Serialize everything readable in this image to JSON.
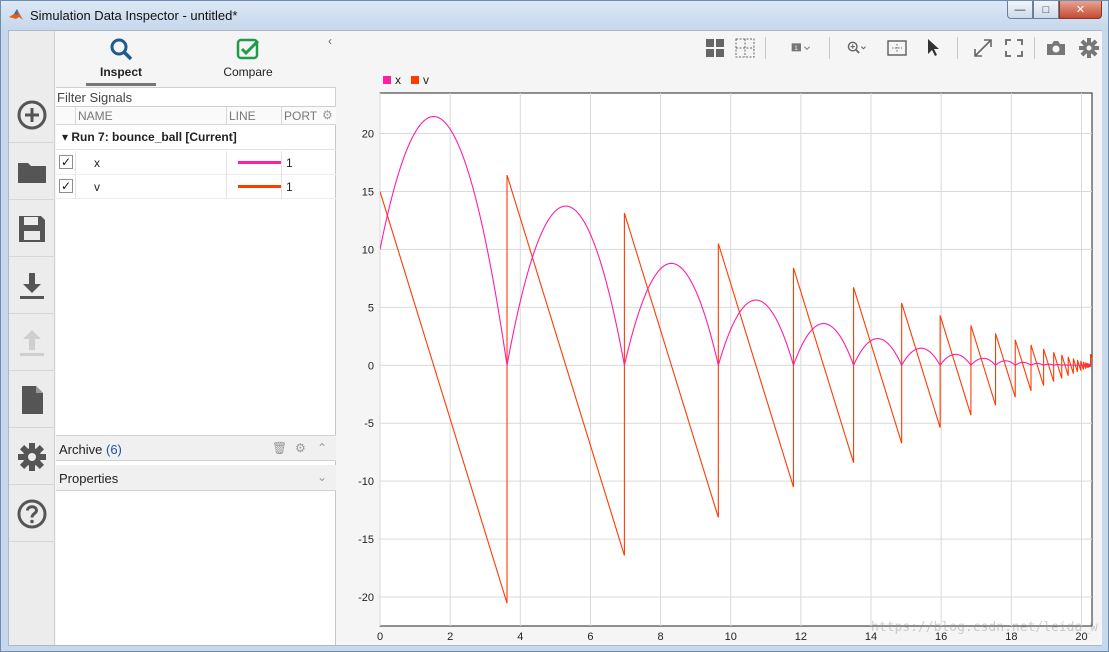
{
  "window": {
    "title": "Simulation Data Inspector - untitled*"
  },
  "tabs": [
    {
      "label": "Inspect",
      "active": true
    },
    {
      "label": "Compare",
      "active": false
    }
  ],
  "filter": {
    "placeholder": "Filter Signals"
  },
  "signal_table": {
    "columns": [
      "NAME",
      "LINE",
      "PORT"
    ],
    "run": {
      "label": "Run 7: bounce_ball [Current]"
    },
    "signals": [
      {
        "name": "x",
        "checked": true,
        "color": "#ff1ea5",
        "port": "1"
      },
      {
        "name": "v",
        "checked": true,
        "color": "#ff3b00",
        "port": "1"
      }
    ]
  },
  "archive": {
    "label": "Archive",
    "count": "(6)"
  },
  "properties": {
    "label": "Properties"
  },
  "rail_icons": [
    "add-icon",
    "folder-icon",
    "save-icon",
    "import-icon",
    "export-icon",
    "report-icon",
    "settings-icon",
    "help-icon"
  ],
  "toolbar_icons": [
    "layout-grid-icon",
    "subplot-icon",
    "cursors-icon",
    "zoom-in-icon",
    "fit-view-icon",
    "pointer-icon",
    "expand-icon",
    "fullscreen-icon",
    "camera-icon",
    "settings-icon"
  ],
  "watermark": "https://blog.csdn.net/leida_w",
  "chart_data": {
    "type": "line",
    "xlim": [
      0,
      20.3
    ],
    "ylim": [
      -22.5,
      23.5
    ],
    "xticks": [
      0,
      2,
      4,
      6,
      8,
      10,
      12,
      14,
      16,
      18,
      20
    ],
    "yticks": [
      -20,
      -15,
      -10,
      -5,
      0,
      5,
      10,
      15,
      20
    ],
    "grid": true,
    "legend_position": "top-left",
    "series": [
      {
        "name": "x",
        "color": "#ff1ea5",
        "model": "bouncing-ball position",
        "x0": 10,
        "v0": 15,
        "g": 9.81,
        "restitution": 0.8
      },
      {
        "name": "v",
        "color": "#ff3b00",
        "model": "bouncing-ball velocity",
        "x0": 10,
        "v0": 15,
        "g": 9.81,
        "restitution": 0.8
      }
    ]
  }
}
